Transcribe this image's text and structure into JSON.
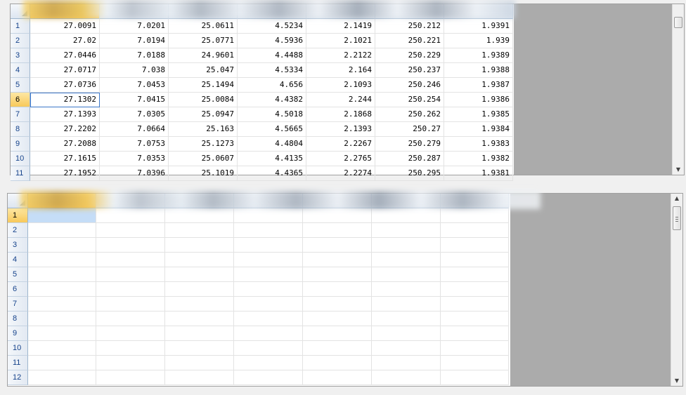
{
  "top_grid": {
    "columns": [
      "",
      "",
      "",
      "",
      "",
      "",
      ""
    ],
    "row_numbers": [
      "1",
      "2",
      "3",
      "4",
      "5",
      "6",
      "7",
      "8",
      "9",
      "10",
      "11"
    ],
    "rows": [
      [
        "27.0091",
        "7.0201",
        "25.0611",
        "4.5234",
        "2.1419",
        "250.212",
        "1.9391"
      ],
      [
        "27.02",
        "7.0194",
        "25.0771",
        "4.5936",
        "2.1021",
        "250.221",
        "1.939"
      ],
      [
        "27.0446",
        "7.0188",
        "24.9601",
        "4.4488",
        "2.2122",
        "250.229",
        "1.9389"
      ],
      [
        "27.0717",
        "7.038",
        "25.047",
        "4.5334",
        "2.164",
        "250.237",
        "1.9388"
      ],
      [
        "27.0736",
        "7.0453",
        "25.1494",
        "4.656",
        "2.1093",
        "250.246",
        "1.9387"
      ],
      [
        "27.1302",
        "7.0415",
        "25.0084",
        "4.4382",
        "2.244",
        "250.254",
        "1.9386"
      ],
      [
        "27.1393",
        "7.0305",
        "25.0947",
        "4.5018",
        "2.1868",
        "250.262",
        "1.9385"
      ],
      [
        "27.2202",
        "7.0664",
        "25.163",
        "4.5665",
        "2.1393",
        "250.27",
        "1.9384"
      ],
      [
        "27.2088",
        "7.0753",
        "25.1273",
        "4.4804",
        "2.2267",
        "250.279",
        "1.9383"
      ],
      [
        "27.1615",
        "7.0353",
        "25.0607",
        "4.4135",
        "2.2765",
        "250.287",
        "1.9382"
      ],
      [
        "27.1952",
        "7.0396",
        "25.1019",
        "4.4365",
        "2.2274",
        "250.295",
        "1.9381"
      ]
    ],
    "selected_row": "6",
    "scroll_down_glyph": "▼"
  },
  "bottom_grid": {
    "columns": [
      "",
      "",
      "",
      "",
      "",
      "",
      ""
    ],
    "row_numbers": [
      "1",
      "2",
      "3",
      "4",
      "5",
      "6",
      "7",
      "8",
      "9",
      "10",
      "11",
      "12"
    ],
    "selected_row": "1",
    "scroll_up_glyph": "▲",
    "scroll_down_glyph": "▼"
  },
  "colors": {
    "header_text": "#15428b",
    "selected_header": "#f6c85f",
    "gray_area": "#ababab",
    "selection_blue": "#c5ddf7"
  }
}
